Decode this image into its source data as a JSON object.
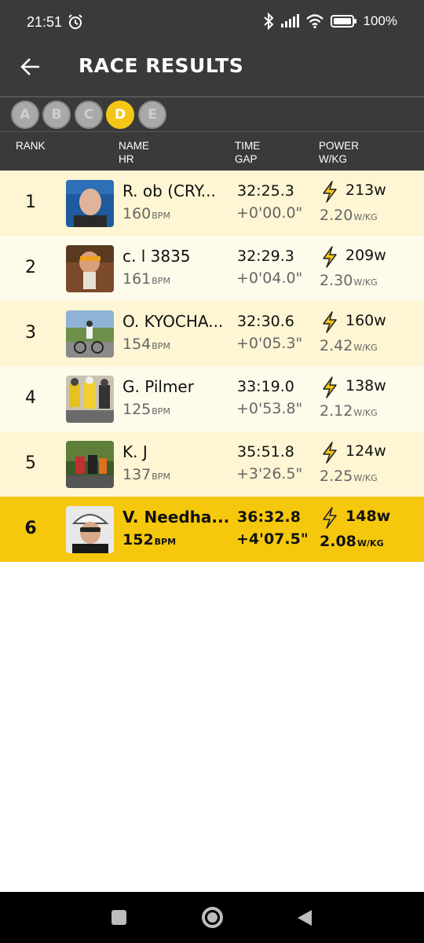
{
  "status_bar": {
    "time": "21:51",
    "battery": "100%"
  },
  "header": {
    "title": "RACE RESULTS"
  },
  "categories": [
    {
      "label": "A",
      "active": false
    },
    {
      "label": "B",
      "active": false
    },
    {
      "label": "C",
      "active": false
    },
    {
      "label": "D",
      "active": true
    },
    {
      "label": "E",
      "active": false
    }
  ],
  "columns": {
    "rank": "RANK",
    "name": "NAME",
    "hr": "HR",
    "time": "TIME",
    "gap": "GAP",
    "power": "POWER",
    "wkg": "W/KG"
  },
  "units": {
    "bpm": "BPM",
    "wkg": "W/KG"
  },
  "results": [
    {
      "rank": "1",
      "name": "R. ob (CRY...",
      "hr": "160",
      "time": "32:25.3",
      "gap": "+0'00.0\"",
      "watts": "213w",
      "wkg": "2.20",
      "highlight": false
    },
    {
      "rank": "2",
      "name": "c. l 3835",
      "hr": "161",
      "time": "32:29.3",
      "gap": "+0'04.0\"",
      "watts": "209w",
      "wkg": "2.30",
      "highlight": false
    },
    {
      "rank": "3",
      "name": "O. KYOCHA...",
      "hr": "154",
      "time": "32:30.6",
      "gap": "+0'05.3\"",
      "watts": "160w",
      "wkg": "2.42",
      "highlight": false
    },
    {
      "rank": "4",
      "name": "G. Pilmer",
      "hr": "125",
      "time": "33:19.0",
      "gap": "+0'53.8\"",
      "watts": "138w",
      "wkg": "2.12",
      "highlight": false
    },
    {
      "rank": "5",
      "name": "K.  J",
      "hr": "137",
      "time": "35:51.8",
      "gap": "+3'26.5\"",
      "watts": "124w",
      "wkg": "2.25",
      "highlight": false
    },
    {
      "rank": "6",
      "name": "V. Needha...",
      "hr": "152",
      "time": "36:32.8",
      "gap": "+4'07.5\"",
      "watts": "148w",
      "wkg": "2.08",
      "highlight": true
    }
  ],
  "colors": {
    "accent": "#f5c518",
    "header_bg": "#3a3a3a",
    "row_odd": "#fdf5d3",
    "row_even": "#fefbeb"
  }
}
